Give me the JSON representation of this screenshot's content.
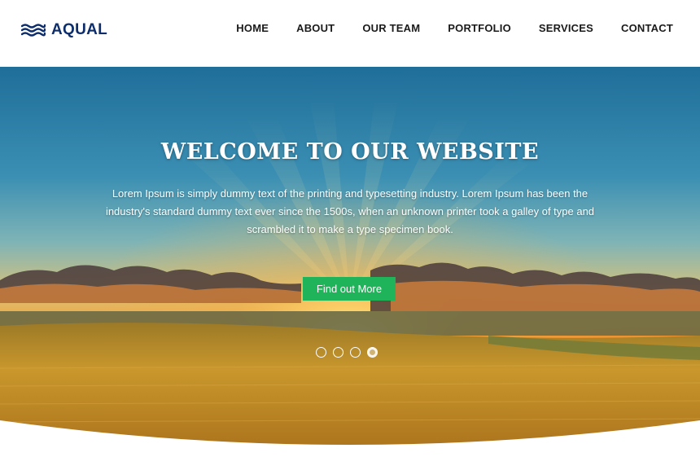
{
  "brand": {
    "name": "AQUAL",
    "icon": "waves-icon",
    "color": "#0d2d6b"
  },
  "nav": {
    "items": [
      {
        "label": "HOME"
      },
      {
        "label": "ABOUT"
      },
      {
        "label": "OUR TEAM"
      },
      {
        "label": "PORTFOLIO"
      },
      {
        "label": "SERVICES"
      },
      {
        "label": "CONTACT"
      }
    ]
  },
  "hero": {
    "title": "WELCOME TO OUR WEBSITE",
    "text": "Lorem Ipsum is simply dummy text of the printing and typesetting industry. Lorem Ipsum has been the industry's standard dummy text ever since the 1500s, when an unknown printer took a galley of type and scrambled it to make a type specimen book.",
    "cta_label": "Find out More",
    "cta_color": "#1fb35a",
    "slider": {
      "total": 4,
      "active": 4
    }
  }
}
